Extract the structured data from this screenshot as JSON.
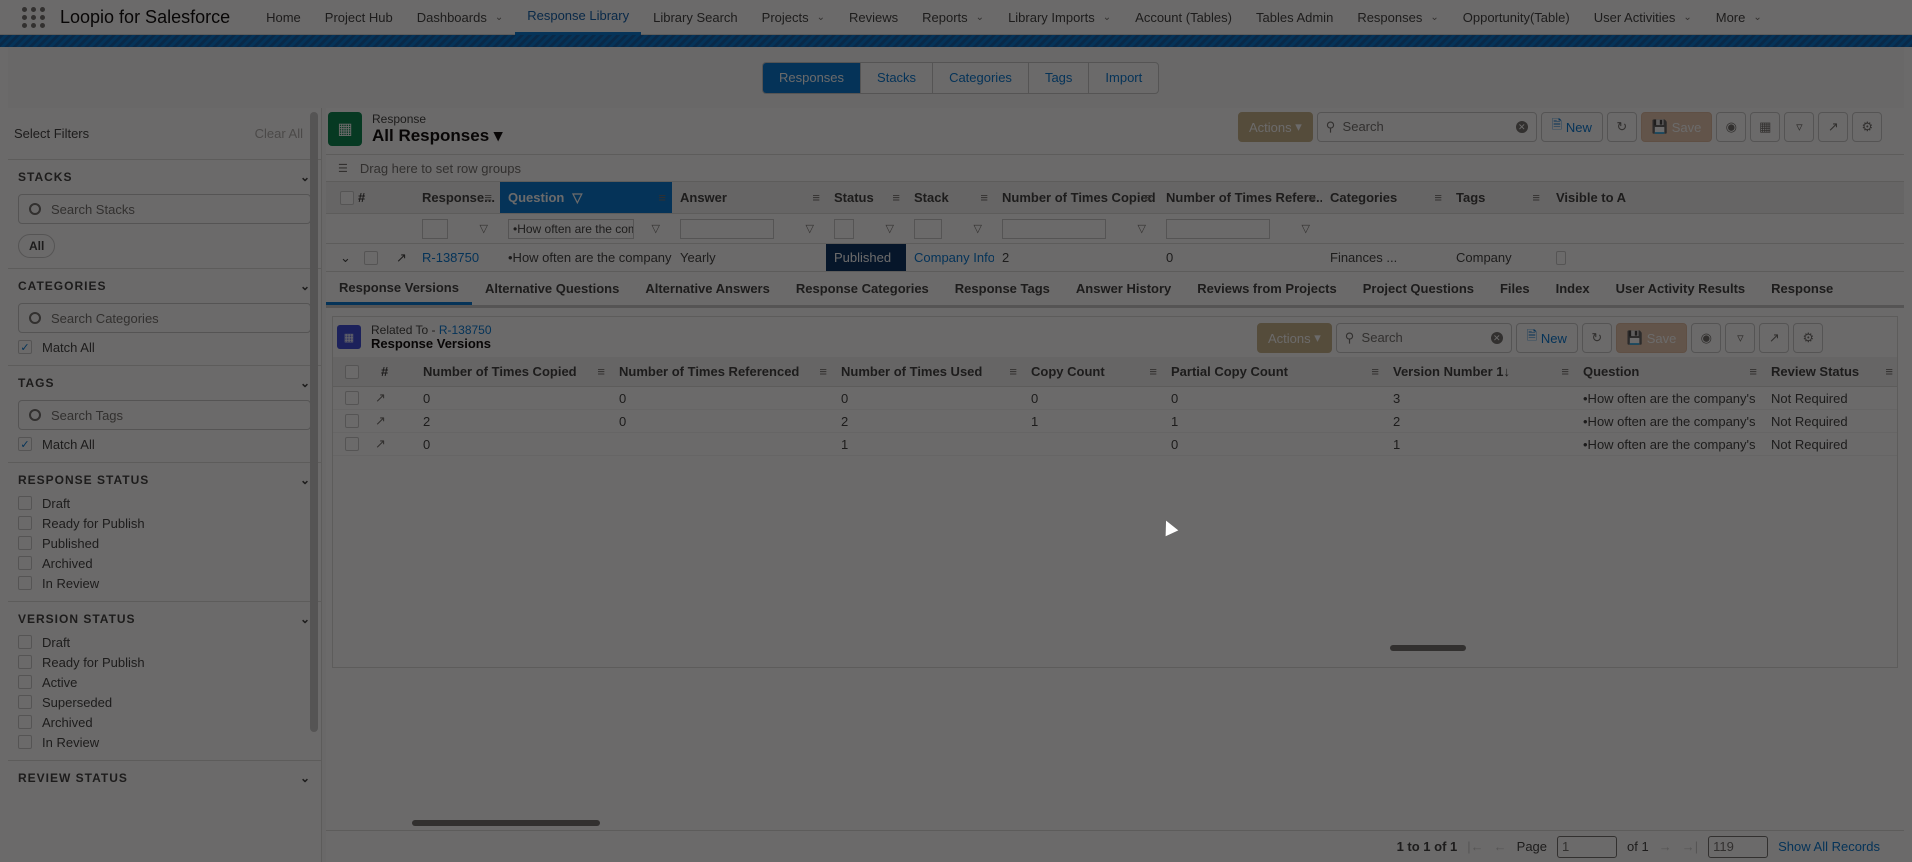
{
  "nav": {
    "app_name": "Loopio for Salesforce",
    "items": [
      {
        "label": "Home",
        "chev": false
      },
      {
        "label": "Project Hub",
        "chev": false
      },
      {
        "label": "Dashboards",
        "chev": true
      },
      {
        "label": "Response Library",
        "chev": false,
        "active": true
      },
      {
        "label": "Library Search",
        "chev": false
      },
      {
        "label": "Projects",
        "chev": true
      },
      {
        "label": "Reviews",
        "chev": false
      },
      {
        "label": "Reports",
        "chev": true
      },
      {
        "label": "Library Imports",
        "chev": true
      },
      {
        "label": "Account (Tables)",
        "chev": false
      },
      {
        "label": "Tables Admin",
        "chev": false
      },
      {
        "label": "Responses",
        "chev": true
      },
      {
        "label": "Opportunity(Table)",
        "chev": false
      },
      {
        "label": "User Activities",
        "chev": true
      },
      {
        "label": "More",
        "chev": true
      }
    ]
  },
  "top_tabs": [
    "Responses",
    "Stacks",
    "Categories",
    "Tags",
    "Import"
  ],
  "sidebar": {
    "title": "Select Filters",
    "clear": "Clear All",
    "stacks": {
      "heading": "STACKS",
      "search": "Search Stacks",
      "pill": "All"
    },
    "categories": {
      "heading": "CATEGORIES",
      "search": "Search Categories",
      "match": "Match All"
    },
    "tags": {
      "heading": "TAGS",
      "search": "Search Tags",
      "match": "Match All"
    },
    "response_status": {
      "heading": "RESPONSE STATUS",
      "options": [
        "Draft",
        "Ready for Publish",
        "Published",
        "Archived",
        "In Review"
      ]
    },
    "version_status": {
      "heading": "VERSION STATUS",
      "options": [
        "Draft",
        "Ready for Publish",
        "Active",
        "Superseded",
        "Archived",
        "In Review"
      ]
    },
    "review_status": {
      "heading": "REVIEW STATUS"
    }
  },
  "grid": {
    "subtitle": "Response",
    "title": "All Responses",
    "actions": "Actions",
    "search": "Search",
    "new": "New",
    "save": "Save",
    "group_hint": "Drag here to set row groups",
    "columns": [
      "#",
      "Response...",
      "Question",
      "Answer",
      "Status",
      "Stack",
      "Number of Times Copied",
      "Number of Times Refere...",
      "Categories",
      "Tags",
      "Visible to As"
    ],
    "filter_question": "•How often are the com",
    "row": {
      "id": "R-138750",
      "question": "•How often are the company's fina",
      "answer": "Yearly",
      "status": "Published",
      "stack": "Company Inforr",
      "copied": "2",
      "referenced": "0",
      "categories": "Finances ...",
      "tags": "Company"
    },
    "detail_tabs": [
      "Response Versions",
      "Alternative Questions",
      "Alternative Answers",
      "Response Categories",
      "Response Tags",
      "Answer History",
      "Reviews from Projects",
      "Project Questions",
      "Files",
      "Index",
      "User Activity Results",
      "Response"
    ],
    "footer": {
      "range": "1 to 1 of 1",
      "page_label": "Page",
      "page": "1",
      "of": "of 1",
      "count": "119",
      "show_all": "Show All Records"
    }
  },
  "related": {
    "prefix": "Related To - ",
    "id": "R-138750",
    "title": "Response Versions",
    "actions": "Actions",
    "search": "Search",
    "new": "New",
    "save": "Save",
    "columns": [
      "#",
      "Number of Times Copied",
      "Number of Times Referenced",
      "Number of Times Used",
      "Copy Count",
      "Partial Copy Count",
      "Version Number 1",
      "Question",
      "Review Status"
    ],
    "rows": [
      [
        "0",
        "0",
        "0",
        "0",
        "0",
        "3",
        "•How often are the company's",
        "Not Required"
      ],
      [
        "2",
        "0",
        "2",
        "1",
        "1",
        "2",
        "•How often are the company's",
        "Not Required"
      ],
      [
        "0",
        "",
        "1",
        "",
        "0",
        "1",
        "•How often are the company's",
        "Not Required"
      ]
    ]
  }
}
